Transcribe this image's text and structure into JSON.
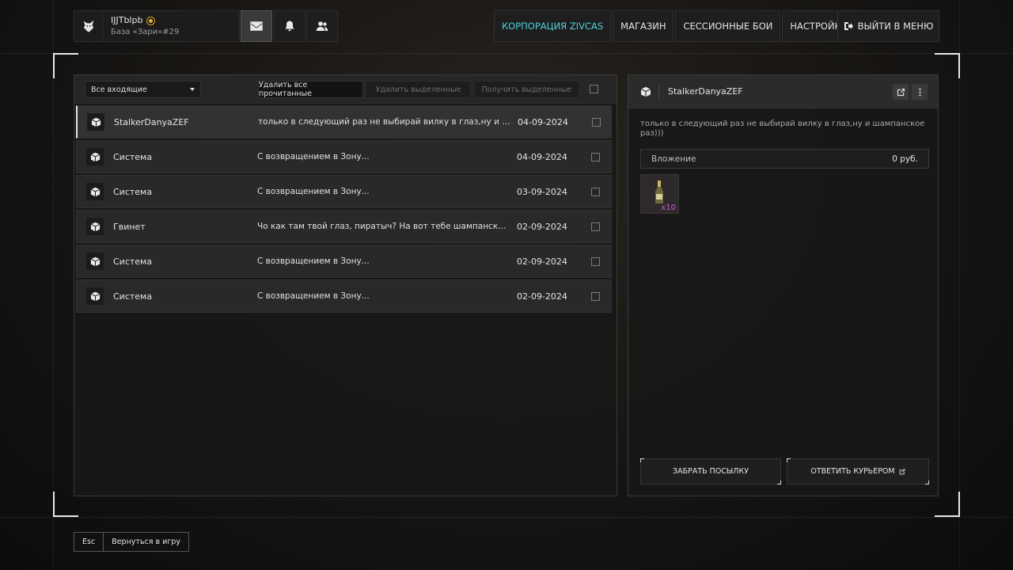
{
  "profile": {
    "name": "IJJTblpb",
    "base": "База «Зари»#29",
    "icon": "wolf-head-icon"
  },
  "top_icons": [
    "mail-icon",
    "bell-icon",
    "friends-icon"
  ],
  "nav": {
    "items": [
      "КОРПОРАЦИЯ ZIVCAS",
      "МАГАЗИН",
      "СЕССИОННЫЕ БОИ",
      "НАСТРОЙКИ"
    ],
    "active_index": 0,
    "active_color": "#4fd1d9",
    "exit_label": "ВЫЙТИ В МЕНЮ"
  },
  "inbox": {
    "filter_value": "Все входящие",
    "delete_read_label": "Удалить все прочитанные",
    "delete_selected_label": "Удалить выделенные",
    "receive_selected_label": "Получить выделенные",
    "messages": [
      {
        "sender": "StalkerDanyaZEF",
        "subject": "только в следующий раз не выбирай вилку в глаз,ну и шампанское раз)))",
        "date": "04-09-2024",
        "selected": true
      },
      {
        "sender": "Система",
        "subject": "С возвращением в Зону...",
        "date": "04-09-2024",
        "selected": false
      },
      {
        "sender": "Система",
        "subject": "С возвращением в Зону...",
        "date": "03-09-2024",
        "selected": false
      },
      {
        "sender": "Гвинет",
        "subject": "Чо как там твой глаз, пиратыч? На вот тебе шампанское, только не пей всё сразу",
        "date": "02-09-2024",
        "selected": false
      },
      {
        "sender": "Система",
        "subject": "С возвращением в Зону...",
        "date": "02-09-2024",
        "selected": false
      },
      {
        "sender": "Система",
        "subject": "С возвращением в Зону...",
        "date": "02-09-2024",
        "selected": false
      }
    ]
  },
  "detail": {
    "sender": "StalkerDanyaZEF",
    "body": "только в следующий раз не выбирай вилку в глаз,ну и шампанское раз)))",
    "attachment_label": "Вложение",
    "attachment_value": "0 руб.",
    "item": {
      "icon": "champagne-bottle-icon",
      "qty": "x10",
      "qty_color": "#c062c8"
    },
    "take_parcel_label": "ЗАБРАТЬ ПОСЫЛКУ",
    "reply_courier_label": "ОТВЕТИТЬ КУРЬЕРОМ"
  },
  "footer": {
    "key": "Esc",
    "label": "Вернуться в игру"
  }
}
